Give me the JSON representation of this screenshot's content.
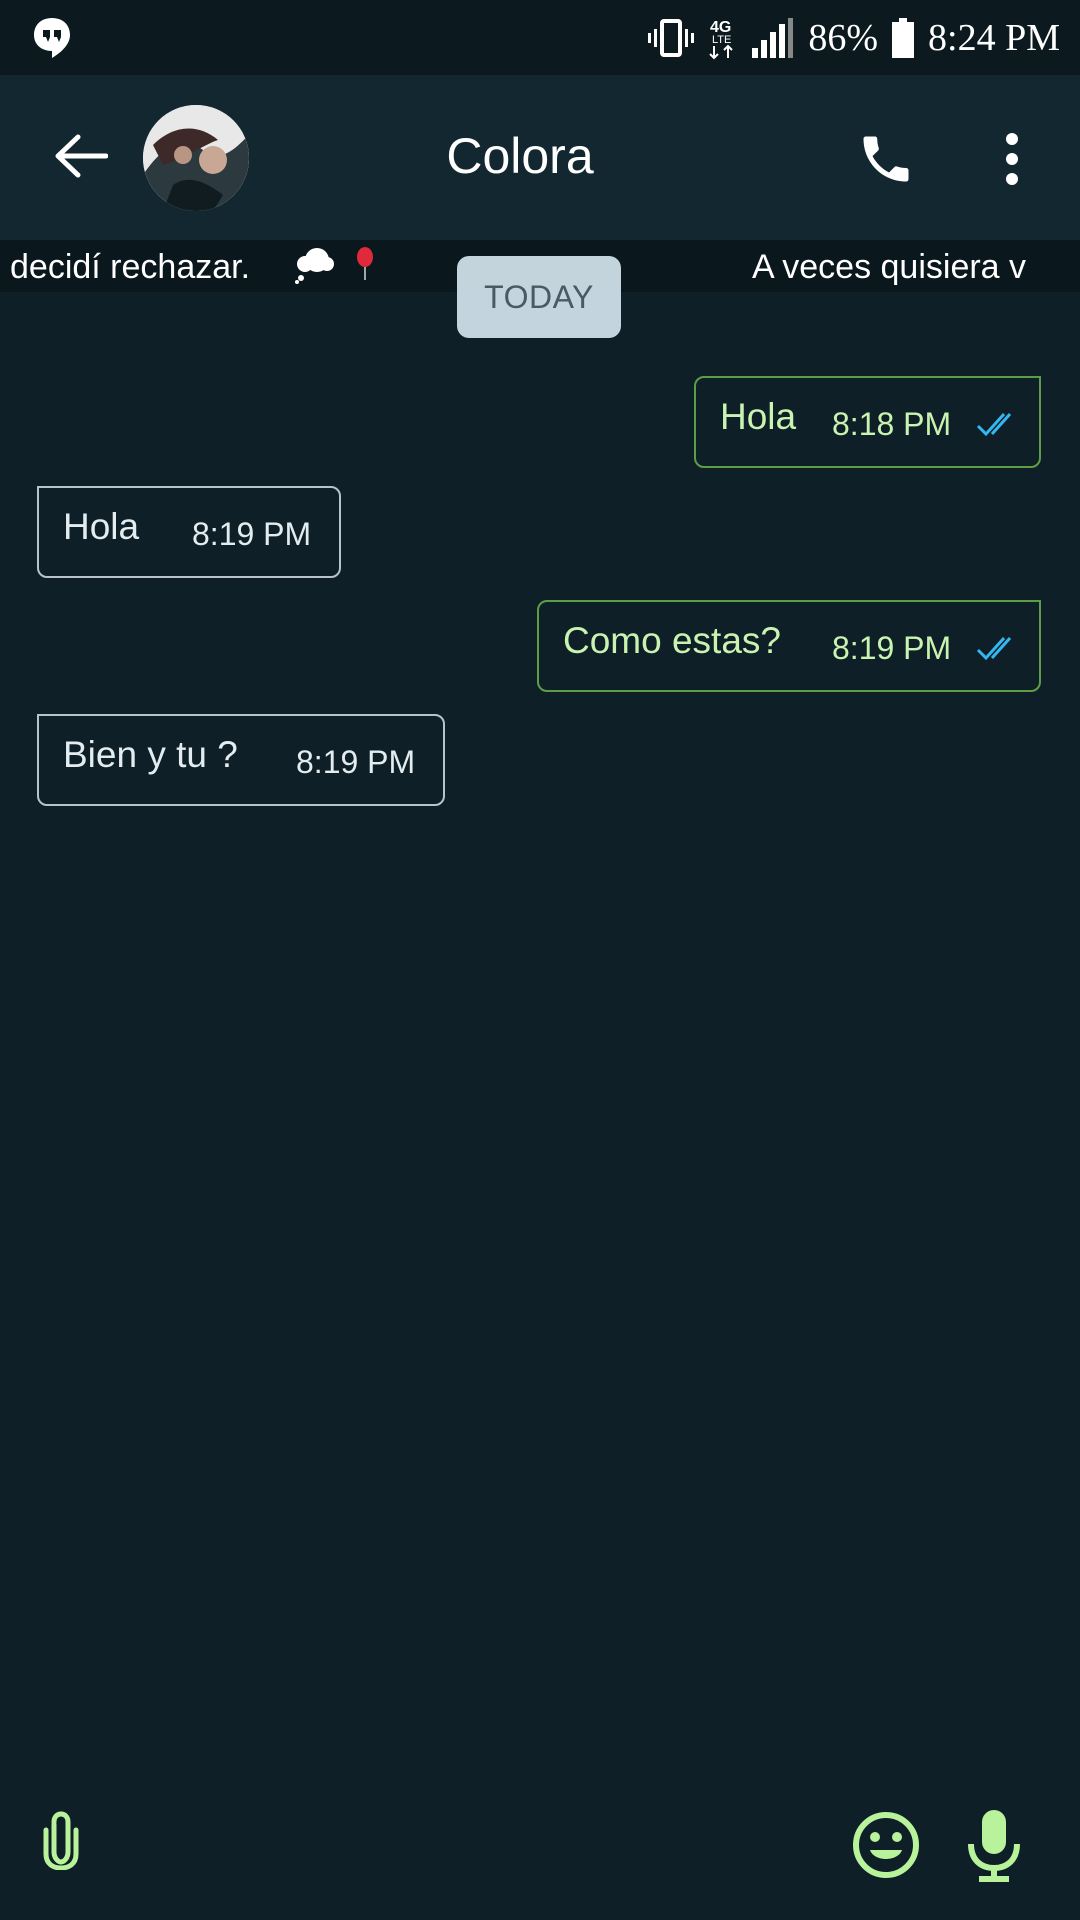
{
  "status_bar": {
    "battery": "86%",
    "time": "8:24 PM",
    "network": "4G"
  },
  "toolbar": {
    "contact_name": "Colora"
  },
  "status_strip": {
    "left_text": "decidí rechazar.",
    "right_text": "A veces quisiera v"
  },
  "date_chip": "TODAY",
  "messages": [
    {
      "direction": "out",
      "text": "Hola",
      "time": "8:18 PM",
      "read": true
    },
    {
      "direction": "in",
      "text": "Hola",
      "time": "8:19 PM"
    },
    {
      "direction": "out",
      "text": "Como estas?",
      "time": "8:19 PM",
      "read": true
    },
    {
      "direction": "in",
      "text": "Bien y tu ?",
      "time": "8:19 PM"
    }
  ],
  "icons": {
    "accent": "#b8f29a",
    "tick_color": "#34b7f1"
  }
}
